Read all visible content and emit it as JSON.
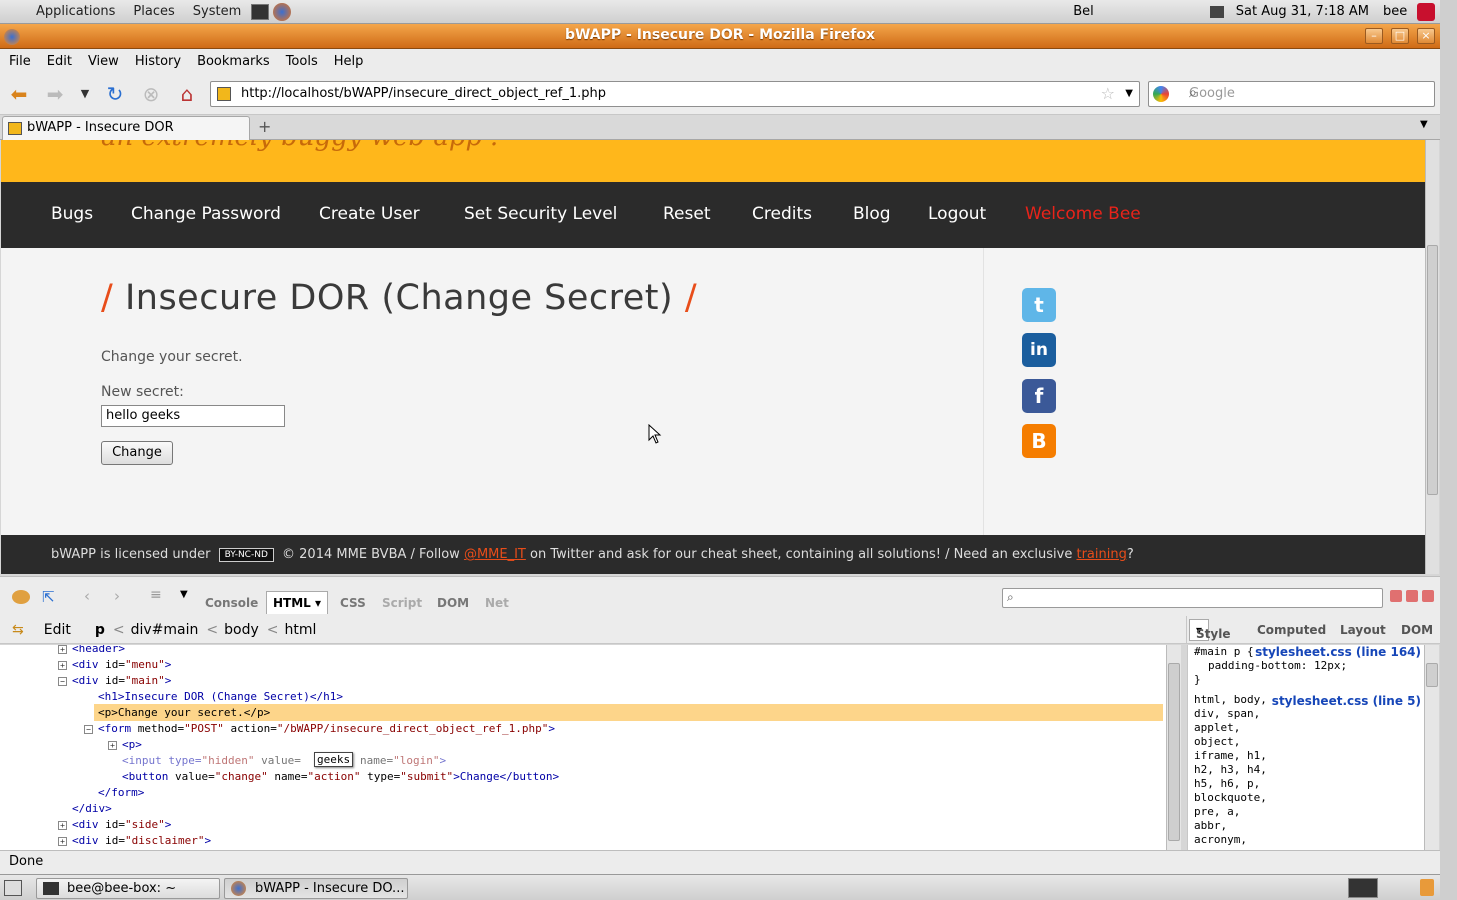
{
  "panel": {
    "applications": "Applications",
    "places": "Places",
    "system": "System",
    "clock": "Sat Aug 31,  7:18 AM",
    "user": "bee",
    "keyboard": "Bel"
  },
  "window": {
    "title": "bWAPP - Insecure DOR - Mozilla Firefox"
  },
  "menubar": {
    "file": "File",
    "edit": "Edit",
    "view": "View",
    "history": "History",
    "bookmarks": "Bookmarks",
    "tools": "Tools",
    "help": "Help"
  },
  "nav": {
    "url": "http://localhost/bWAPP/insecure_direct_object_ref_1.php",
    "search_placeholder": "Google"
  },
  "tabs": [
    {
      "label": "bWAPP - Insecure DOR"
    }
  ],
  "site": {
    "tagline": "an extremely buggy web app !",
    "menu": [
      "Bugs",
      "Change Password",
      "Create User",
      "Set Security Level",
      "Reset",
      "Credits",
      "Blog",
      "Logout",
      "Welcome Bee"
    ],
    "heading_slash": "/",
    "heading": "Insecure DOR (Change Secret)",
    "intro": "Change your secret.",
    "field_label": "New secret:",
    "field_value": "hello geeks",
    "button": "Change",
    "social": [
      "t",
      "in",
      "f",
      "B"
    ],
    "footer": {
      "pre": "bWAPP is licensed under",
      "badge": "BY-NC-ND",
      "mid": "© 2014 MME BVBA / Follow",
      "handle": "@MME_IT",
      "post": "on Twitter and ask for our cheat sheet, containing all solutions! / Need an exclusive",
      "training": "training",
      "end": "?"
    }
  },
  "firebug": {
    "tabs": [
      "Console",
      "HTML",
      "CSS",
      "Script",
      "DOM",
      "Net"
    ],
    "edit": "Edit",
    "breadcrumbs": [
      "p",
      "div#main",
      "body",
      "html"
    ],
    "side_tabs": [
      "Style",
      "Computed",
      "Layout",
      "DOM"
    ],
    "html": {
      "l1": "<header>",
      "l2a": "<div ",
      "l2b": "id=",
      "l2c": "\"menu\"",
      "l2d": ">",
      "l3c": "\"main\"",
      "h1": "<h1>Insecure DOR (Change Secret)</h1>",
      "p": "<p>Change your secret.</p>",
      "form_a": "<form ",
      "form_b": "method=",
      "form_c": "\"POST\"",
      "form_d": " action=",
      "form_e": "\"/bWAPP/insecure_direct_object_ref_1.php\"",
      "form_f": ">",
      "pp": "<p>",
      "input_a": "<input type=",
      "input_b": "\"hidden\"",
      "input_c": " value=",
      "input_edit": "geeks",
      "input_d": " name=",
      "input_e": "\"login\"",
      "input_f": ">",
      "btn_a": "<button ",
      "btn_b": "value=",
      "btn_c": "\"change\"",
      "btn_d": " name=",
      "btn_e": "\"action\"",
      "btn_f": " type=",
      "btn_g": "\"submit\"",
      "btn_h": ">Change</button>",
      "form_close": "</form>",
      "div_close": "</div>",
      "side_c": "\"side\"",
      "disc_c": "\"disclaimer\""
    },
    "style": {
      "rule1_sel": "#main p {",
      "rule1_src": "stylesheet.css (line 164)",
      "rule1_prop": "padding-bottom: 12px;",
      "rule1_end": "}",
      "rule2_src": "stylesheet.css (line 5)",
      "rule2_sel": [
        "html, body,",
        "div, span,",
        "applet,",
        "object,",
        "iframe, h1,",
        "h2, h3, h4,",
        "h5, h6, p,",
        "blockquote,",
        "pre, a,",
        "abbr,",
        "acronym,"
      ]
    }
  },
  "status": "Done",
  "taskbar": [
    "bee@bee-box: ~",
    "bWAPP - Insecure DO..."
  ],
  "colors": {
    "accent": "#e84d1a",
    "header": "#ffb71b",
    "nav": "#2b2b2b"
  }
}
